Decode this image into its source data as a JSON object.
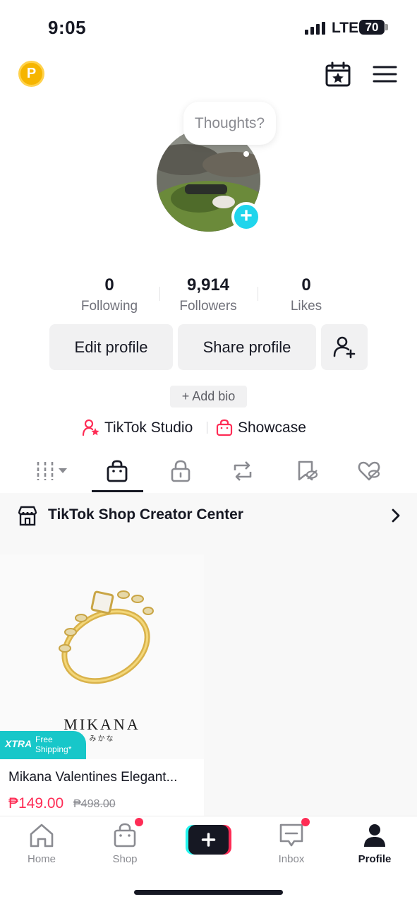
{
  "status_bar": {
    "time": "9:05",
    "network": "LTE",
    "battery": "70"
  },
  "header": {
    "coin_letter": "P"
  },
  "profile": {
    "thought_bubble": "Thoughts?",
    "stats": [
      {
        "value": "0",
        "label": "Following"
      },
      {
        "value": "9,914",
        "label": "Followers"
      },
      {
        "value": "0",
        "label": "Likes"
      }
    ],
    "edit_button": "Edit profile",
    "share_button": "Share profile",
    "add_bio": "+ Add bio",
    "studio_link": "TikTok Studio",
    "showcase_link": "Showcase"
  },
  "creator_center": {
    "label": "TikTok Shop Creator Center"
  },
  "product": {
    "brand": "MIKANA",
    "brand_sub": "みかな",
    "badge_label": "XTRA",
    "badge_text_line1": "Free",
    "badge_text_line2": "Shipping*",
    "title": "Mikana Valentines Elegant...",
    "price": "₱149.00",
    "old_price": "₱498.00"
  },
  "nav": {
    "home": "Home",
    "shop": "Shop",
    "inbox": "Inbox",
    "profile": "Profile"
  },
  "colors": {
    "accent": "#fe2c55",
    "cyan": "#20d5ec",
    "coin": "#f6b500"
  }
}
